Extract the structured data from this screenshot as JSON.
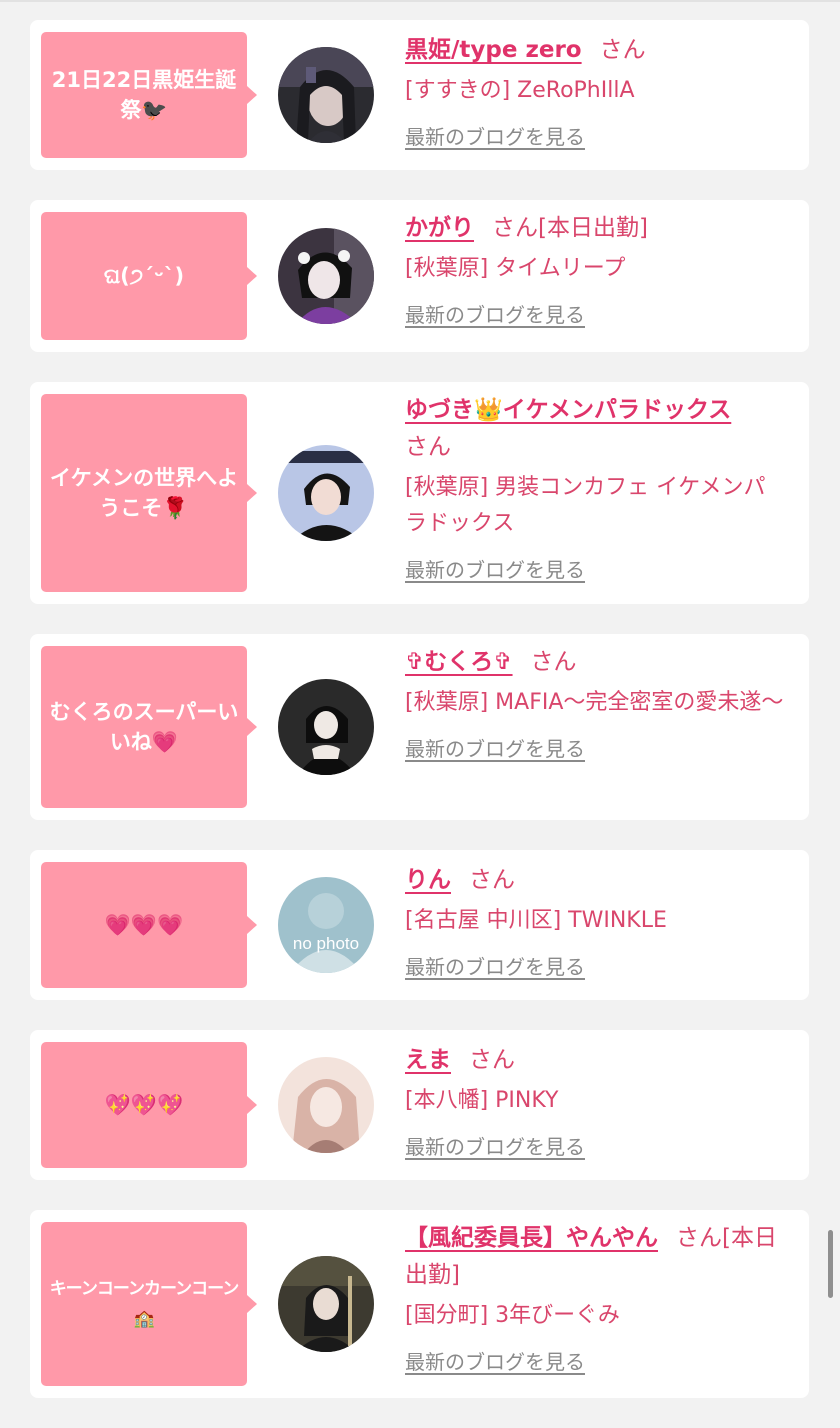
{
  "entries": [
    {
      "bubble": "21日22日黒姫生誕祭🐦‍⬛",
      "name": "黒姫/type zero",
      "san": "さん",
      "place": "[すすきの] ZeRoPhIllA",
      "blog": "最新のブログを見る",
      "avatar_colors": [
        "#2b2b30",
        "#d8c9c6",
        "#5e5a78"
      ]
    },
    {
      "bubble": "ଘ(੭ˊᵕˋ)",
      "name": "かがり",
      "san": "さん[本日出勤]",
      "place": "[秋葉原] タイムリープ",
      "blog": "最新のブログを見る",
      "avatar_colors": [
        "#3c3440",
        "#efe6e8",
        "#7c3ea0"
      ]
    },
    {
      "bubble": "イケメンの世界へようこそ🌹",
      "name": "ゆづき👑イケメンパラドックス",
      "san": "さん",
      "place": "[秋葉原] 男装コンカフェ イケメンパラドックス",
      "blog": "最新のブログを見る",
      "avatar_colors": [
        "#b9c6e6",
        "#141414",
        "#f1dcd4"
      ]
    },
    {
      "bubble": "むくろのスーパーいいね💗",
      "name": "✞むくろ✞",
      "san": "さん",
      "place": "[秋葉原] MAFIA〜完全密室の愛未遂〜",
      "blog": "最新のブログを見る",
      "avatar_colors": [
        "#2a2a2a",
        "#efe9e4",
        "#0d0d0d"
      ]
    },
    {
      "bubble": "💗💗💗",
      "name": "りん",
      "san": "さん",
      "place": "[名古屋 中川区] TWINKLE",
      "blog": "最新のブログを見る",
      "avatar_label": "no photo",
      "avatar_colors": [
        "#9fc1cc",
        "#cfe0e5",
        "#ffffff"
      ]
    },
    {
      "bubble": "💖💖💖",
      "name": "えま",
      "san": "さん",
      "place": "[本八幡] PINKY",
      "blog": "最新のブログを見る",
      "avatar_colors": [
        "#d9b3a7",
        "#f3e3dc",
        "#a67d74"
      ]
    },
    {
      "bubble": "キーンコーンカーンコーン🏫",
      "name": "【風紀委員長】やんやん",
      "san": "さん[本日出勤]",
      "place": "[国分町] 3年びーぐみ",
      "blog": "最新のブログを見る",
      "avatar_colors": [
        "#3d3a30",
        "#e9dcd3",
        "#1a1a1a"
      ]
    }
  ]
}
